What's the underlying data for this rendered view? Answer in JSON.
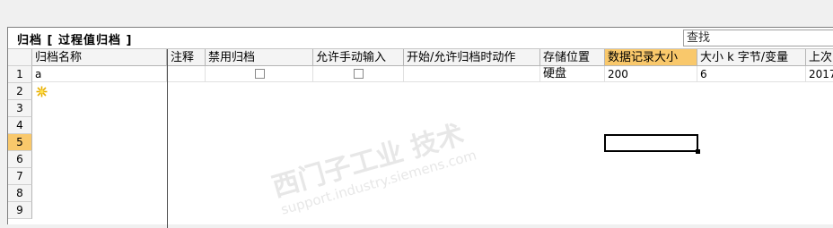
{
  "panel": {
    "title": "归档 [ 过程值归档 ]",
    "search_value": "查找"
  },
  "table": {
    "columns": [
      "归档名称",
      "注释",
      "禁用归档",
      "允许手动输入",
      "开始/允许归档时动作",
      "存储位置",
      "数据记录大小",
      "大小 k 字节/变量",
      "上次"
    ],
    "selected_column_index": 6,
    "selected_row_number": "5",
    "row_numbers": [
      "1",
      "2",
      "3",
      "4",
      "5",
      "6",
      "7",
      "8",
      "9"
    ],
    "rows": [
      {
        "name": "a",
        "comment": "",
        "disable_archive": false,
        "allow_manual_input": false,
        "start_action": "",
        "storage_location": "硬盘",
        "record_size": "200",
        "size_kb_per_tag": "6",
        "last": "2017/"
      }
    ]
  },
  "watermark": {
    "line1": "西门子工业 技术",
    "line2": "support.industry.siemens.com"
  }
}
